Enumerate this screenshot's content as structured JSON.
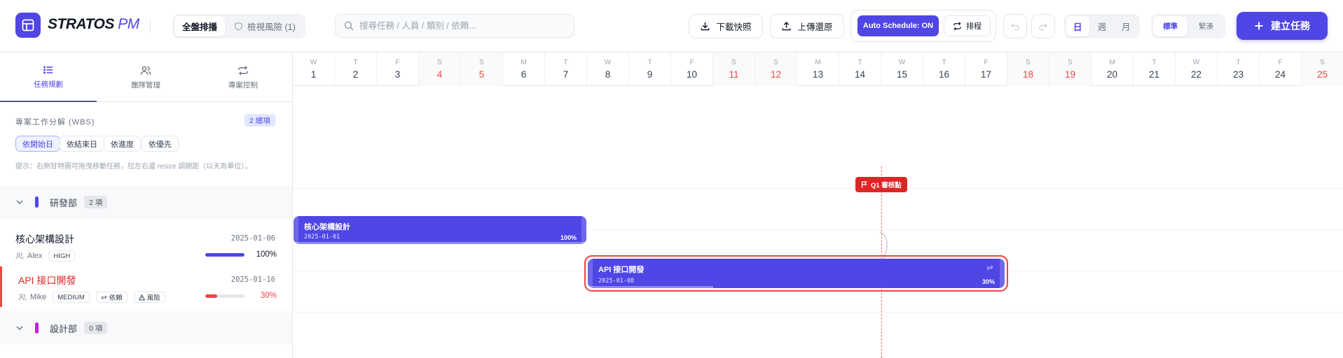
{
  "header": {
    "brand_a": "STRATOS",
    "brand_b": "PM",
    "view_tabs": [
      {
        "label": "全盤排播",
        "active": true
      },
      {
        "label": "檢視風險 (1)",
        "active": false
      }
    ],
    "search": {
      "placeholder": "搜尋任務 / 人員 / 類別 / 依賴..."
    },
    "download_label": "下載快照",
    "upload_label": "上傳還原",
    "auto_schedule_label": "Auto Schedule: ON",
    "schedule_label": "排程",
    "zoom_tabs": [
      {
        "label": "日",
        "active": true
      },
      {
        "label": "週",
        "active": false
      },
      {
        "label": "月",
        "active": false
      }
    ],
    "theme_tabs": [
      {
        "label": "標準",
        "active": true
      },
      {
        "label": "緊湊",
        "active": false
      }
    ],
    "create_label": "建立任務",
    "accent_color": "#4f46e5"
  },
  "sidebar": {
    "tabs": [
      {
        "label": "任務規劃",
        "icon": "list-icon",
        "active": true
      },
      {
        "label": "團隊管理",
        "icon": "users-icon",
        "active": false
      },
      {
        "label": "專案控制",
        "icon": "repeat-icon",
        "active": false
      }
    ],
    "wbs_title": "專案工作分解 (WBS)",
    "wbs_count": "2 總項",
    "sort_chips": [
      {
        "label": "依開始日",
        "active": true
      },
      {
        "label": "依結束日",
        "active": false
      },
      {
        "label": "依進度",
        "active": false
      },
      {
        "label": "依優先",
        "active": false
      }
    ],
    "hint": "提示：右側甘特圖可拖曳移動任務，拉左右邊 resize 調期距（以天為單位）。",
    "groups": [
      {
        "name": "研發部",
        "count": "2 項",
        "color": "#4f46e5",
        "tasks": [
          {
            "name": "核心架構設計",
            "date": "2025-01-06",
            "owner": "Alex",
            "priority": "HIGH",
            "progress": "100%",
            "progress_value": 1.0,
            "tags": [],
            "risk": false
          },
          {
            "name": "API 接口開發",
            "date": "2025-01-16",
            "owner": "Mike",
            "priority": "MEDIUM",
            "progress": "30%",
            "progress_value": 0.3,
            "tags": [
              "依賴",
              "風險"
            ],
            "risk": true
          }
        ]
      },
      {
        "name": "設計部",
        "count": "0 項",
        "color": "#c026d3",
        "tasks": []
      }
    ]
  },
  "gantt": {
    "days": [
      {
        "dow": "W",
        "num": "1"
      },
      {
        "dow": "T",
        "num": "2"
      },
      {
        "dow": "F",
        "num": "3"
      },
      {
        "dow": "S",
        "num": "4"
      },
      {
        "dow": "S",
        "num": "5"
      },
      {
        "dow": "M",
        "num": "6"
      },
      {
        "dow": "T",
        "num": "7"
      },
      {
        "dow": "W",
        "num": "8"
      },
      {
        "dow": "T",
        "num": "9"
      },
      {
        "dow": "F",
        "num": "10"
      },
      {
        "dow": "S",
        "num": "11"
      },
      {
        "dow": "S",
        "num": "12"
      },
      {
        "dow": "M",
        "num": "13"
      },
      {
        "dow": "T",
        "num": "14"
      },
      {
        "dow": "W",
        "num": "15"
      },
      {
        "dow": "T",
        "num": "16"
      },
      {
        "dow": "F",
        "num": "17"
      },
      {
        "dow": "S",
        "num": "18"
      },
      {
        "dow": "S",
        "num": "19"
      },
      {
        "dow": "M",
        "num": "20"
      },
      {
        "dow": "T",
        "num": "21"
      },
      {
        "dow": "W",
        "num": "22"
      },
      {
        "dow": "T",
        "num": "23"
      },
      {
        "dow": "F",
        "num": "24"
      },
      {
        "dow": "S",
        "num": "25"
      }
    ],
    "weekend_color": "#ef4444",
    "milestone": {
      "label": "Q1 審核點",
      "color": "#dc2626"
    },
    "bars": [
      {
        "name": "核心架構設計",
        "start_label": "2025-01-01",
        "progress": "100%",
        "progress_value": 1.0
      },
      {
        "name": "API 接口開發",
        "start_label": "2025-01-08",
        "progress": "30%",
        "progress_value": 0.3
      }
    ]
  }
}
